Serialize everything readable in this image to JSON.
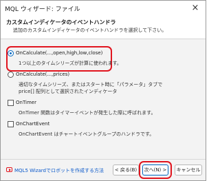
{
  "window": {
    "title": "MQL ウィザード: ファイル",
    "close_icon": "×"
  },
  "header": {
    "title": "カスタムインディケータのイベントハンドラ",
    "subtitle": "追加のカスタムインディケータのイベントハンドラを選択して下さい。"
  },
  "options": [
    {
      "label": "OnCalculate(...,open,high,low,close)",
      "type": "radio",
      "checked": true,
      "desc": [
        "1つ以上のタイムシリーズが計算に使われます。"
      ]
    },
    {
      "label": "OnCalculate(...,prices)",
      "type": "radio",
      "checked": false,
      "desc": [
        "適切なタイムシリーズ、またはスタート時に「パラメータ」タブで",
        "price[] 配列として選択されたインディケータ"
      ]
    },
    {
      "label": "OnTimer",
      "type": "checkbox",
      "checked": false,
      "desc": [
        "OnTimer 関数はタイマーイベントが発生した際に呼ばれます。"
      ]
    },
    {
      "label": "OnChartEvent",
      "type": "checkbox",
      "checked": false,
      "desc": [
        "OnChartEvent はチャートイベントグループのハンドラです。"
      ]
    }
  ],
  "footer": {
    "help_link": "MQL5 Wizardでロボットを作成する方法",
    "back_label": "< 戻る(B)",
    "next_label": "次へ(N) >",
    "cancel_label": "キャンセル"
  },
  "colors": {
    "highlight": "#e1141e",
    "accent": "#0067c0",
    "link": "#0a58ca"
  }
}
